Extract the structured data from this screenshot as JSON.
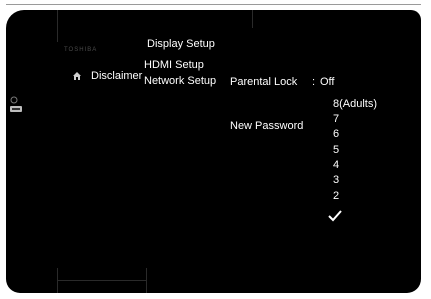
{
  "brand_text": "TOSHIBA",
  "menu": {
    "disclaimer": "Disclaimer",
    "items": [
      "Display Setup",
      "HDMI Setup",
      "Network Setup"
    ]
  },
  "parental": {
    "label": "Parental Lock",
    "separator": ":",
    "value": "Off"
  },
  "new_password_label": "New Password",
  "options": [
    "8(Adults)",
    "7",
    "6",
    "5",
    "4",
    "3",
    "2"
  ],
  "check_icon": "checkmark-icon"
}
